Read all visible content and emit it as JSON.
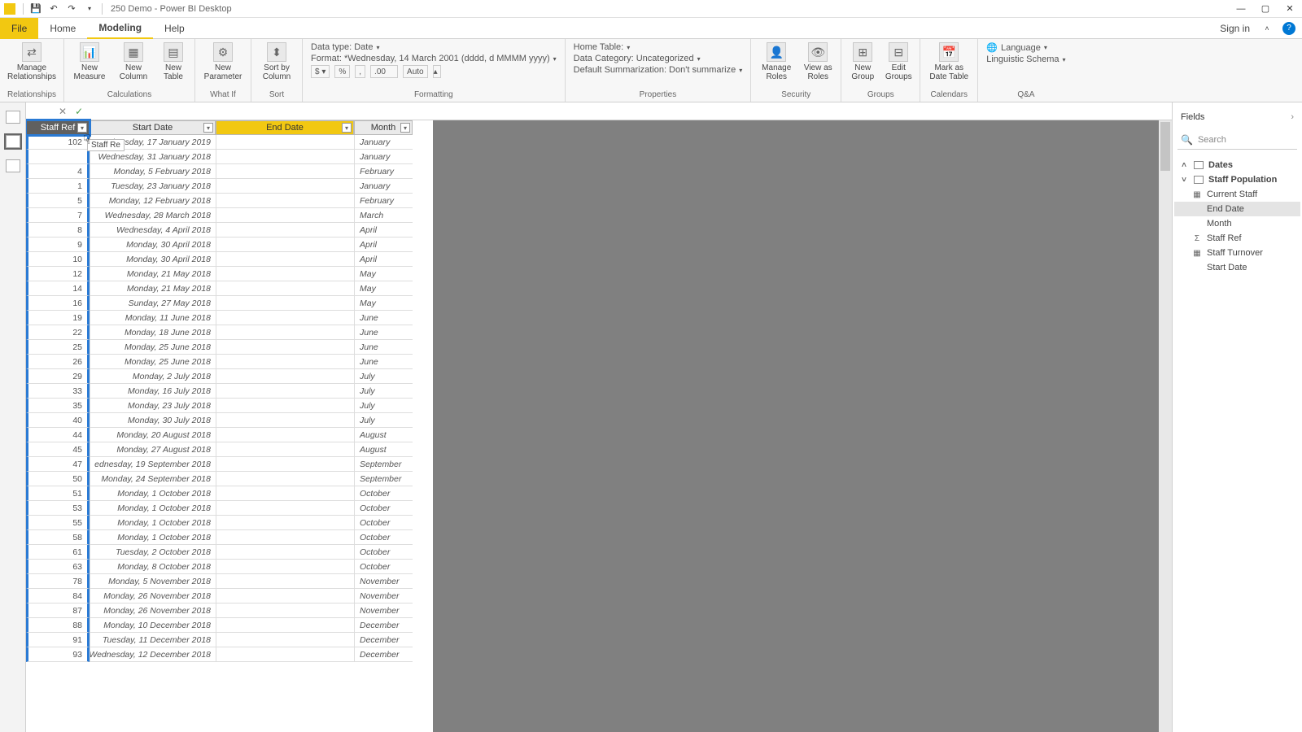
{
  "title": {
    "app": "250 Demo - Power BI Desktop"
  },
  "menu": {
    "file": "File",
    "home": "Home",
    "modeling": "Modeling",
    "help": "Help",
    "sign_in": "Sign in"
  },
  "ribbon": {
    "relationships": {
      "manage": "Manage\nRelationships",
      "group": "Relationships"
    },
    "calculations": {
      "measure": "New\nMeasure",
      "column": "New\nColumn",
      "table": "New\nTable",
      "group": "Calculations"
    },
    "whatif": {
      "param": "New\nParameter",
      "group": "What If"
    },
    "sort": {
      "btn": "Sort by\nColumn",
      "group": "Sort"
    },
    "formatting": {
      "datatype": "Data type: Date",
      "format": "Format: *Wednesday, 14 March 2001 (dddd, d MMMM yyyy)",
      "auto": "Auto",
      "group": "Formatting"
    },
    "properties": {
      "hometable": "Home Table:",
      "category": "Data Category: Uncategorized",
      "summarization": "Default Summarization: Don't summarize",
      "group": "Properties"
    },
    "security": {
      "manage": "Manage\nRoles",
      "view": "View as\nRoles",
      "group": "Security"
    },
    "groups": {
      "new": "New\nGroup",
      "edit": "Edit\nGroups",
      "group": "Groups"
    },
    "calendars": {
      "mark": "Mark as\nDate Table",
      "group": "Calendars"
    },
    "qa": {
      "lang": "Language",
      "schema": "Linguistic Schema",
      "group": "Q&A"
    }
  },
  "columns": {
    "staff_ref": "Staff Ref",
    "start_date": "Start Date",
    "end_date": "End Date",
    "month": "Month"
  },
  "tooltip": "Staff Re",
  "rows": [
    {
      "ref": "102",
      "start": "Thursday, 17 January 2019",
      "end": "",
      "month": "January"
    },
    {
      "ref": "",
      "start": "Wednesday, 31 January 2018",
      "end": "",
      "month": "January"
    },
    {
      "ref": "4",
      "start": "Monday, 5 February 2018",
      "end": "",
      "month": "February"
    },
    {
      "ref": "1",
      "start": "Tuesday, 23 January 2018",
      "end": "",
      "month": "January"
    },
    {
      "ref": "5",
      "start": "Monday, 12 February 2018",
      "end": "",
      "month": "February"
    },
    {
      "ref": "7",
      "start": "Wednesday, 28 March 2018",
      "end": "",
      "month": "March"
    },
    {
      "ref": "8",
      "start": "Wednesday, 4 April 2018",
      "end": "",
      "month": "April"
    },
    {
      "ref": "9",
      "start": "Monday, 30 April 2018",
      "end": "",
      "month": "April"
    },
    {
      "ref": "10",
      "start": "Monday, 30 April 2018",
      "end": "",
      "month": "April"
    },
    {
      "ref": "12",
      "start": "Monday, 21 May 2018",
      "end": "",
      "month": "May"
    },
    {
      "ref": "14",
      "start": "Monday, 21 May 2018",
      "end": "",
      "month": "May"
    },
    {
      "ref": "16",
      "start": "Sunday, 27 May 2018",
      "end": "",
      "month": "May"
    },
    {
      "ref": "19",
      "start": "Monday, 11 June 2018",
      "end": "",
      "month": "June"
    },
    {
      "ref": "22",
      "start": "Monday, 18 June 2018",
      "end": "",
      "month": "June"
    },
    {
      "ref": "25",
      "start": "Monday, 25 June 2018",
      "end": "",
      "month": "June"
    },
    {
      "ref": "26",
      "start": "Monday, 25 June 2018",
      "end": "",
      "month": "June"
    },
    {
      "ref": "29",
      "start": "Monday, 2 July 2018",
      "end": "",
      "month": "July"
    },
    {
      "ref": "33",
      "start": "Monday, 16 July 2018",
      "end": "",
      "month": "July"
    },
    {
      "ref": "35",
      "start": "Monday, 23 July 2018",
      "end": "",
      "month": "July"
    },
    {
      "ref": "40",
      "start": "Monday, 30 July 2018",
      "end": "",
      "month": "July"
    },
    {
      "ref": "44",
      "start": "Monday, 20 August 2018",
      "end": "",
      "month": "August"
    },
    {
      "ref": "45",
      "start": "Monday, 27 August 2018",
      "end": "",
      "month": "August"
    },
    {
      "ref": "47",
      "start": "ednesday, 19 September 2018",
      "end": "",
      "month": "September"
    },
    {
      "ref": "50",
      "start": "Monday, 24 September 2018",
      "end": "",
      "month": "September"
    },
    {
      "ref": "51",
      "start": "Monday, 1 October 2018",
      "end": "",
      "month": "October"
    },
    {
      "ref": "53",
      "start": "Monday, 1 October 2018",
      "end": "",
      "month": "October"
    },
    {
      "ref": "55",
      "start": "Monday, 1 October 2018",
      "end": "",
      "month": "October"
    },
    {
      "ref": "58",
      "start": "Monday, 1 October 2018",
      "end": "",
      "month": "October"
    },
    {
      "ref": "61",
      "start": "Tuesday, 2 October 2018",
      "end": "",
      "month": "October"
    },
    {
      "ref": "63",
      "start": "Monday, 8 October 2018",
      "end": "",
      "month": "October"
    },
    {
      "ref": "78",
      "start": "Monday, 5 November 2018",
      "end": "",
      "month": "November"
    },
    {
      "ref": "84",
      "start": "Monday, 26 November 2018",
      "end": "",
      "month": "November"
    },
    {
      "ref": "87",
      "start": "Monday, 26 November 2018",
      "end": "",
      "month": "November"
    },
    {
      "ref": "88",
      "start": "Monday, 10 December 2018",
      "end": "",
      "month": "December"
    },
    {
      "ref": "91",
      "start": "Tuesday, 11 December 2018",
      "end": "",
      "month": "December"
    },
    {
      "ref": "93",
      "start": "Wednesday, 12 December 2018",
      "end": "",
      "month": "December"
    }
  ],
  "fields": {
    "title": "Fields",
    "search": "Search",
    "tables": [
      {
        "name": "Dates",
        "expanded": false
      },
      {
        "name": "Staff Population",
        "expanded": true,
        "fields": [
          {
            "name": "Current Staff",
            "icon": "measure"
          },
          {
            "name": "End Date",
            "selected": true
          },
          {
            "name": "Month"
          },
          {
            "name": "Staff Ref",
            "icon": "sigma"
          },
          {
            "name": "Staff Turnover",
            "icon": "measure"
          },
          {
            "name": "Start Date"
          }
        ]
      }
    ]
  }
}
